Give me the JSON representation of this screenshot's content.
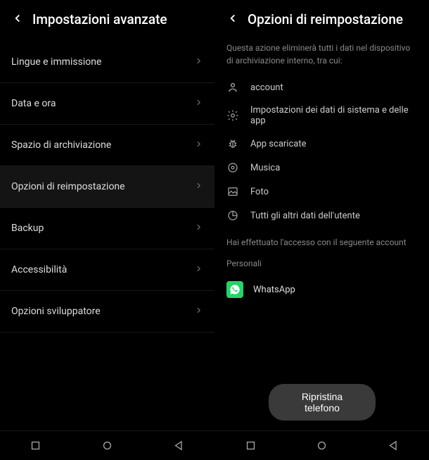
{
  "left": {
    "title": "Impostazioni avanzate",
    "items": [
      {
        "label": "Lingue e immissione"
      },
      {
        "label": "Data e ora"
      },
      {
        "label": "Spazio di archiviazione"
      },
      {
        "label": "Opzioni di reimpostazione",
        "selected": true
      },
      {
        "label": "Backup"
      },
      {
        "label": "Accessibilità"
      },
      {
        "label": "Opzioni sviluppatore"
      }
    ]
  },
  "right": {
    "title": "Opzioni di reimpostazione",
    "description": "Questa azione eliminerà tutti i dati nel dispositivo di archiviazione interno, tra cui:",
    "data_items": [
      {
        "icon": "person-icon",
        "label": "account"
      },
      {
        "icon": "gear-icon",
        "label": "Impostazioni dei dati di sistema e delle app"
      },
      {
        "icon": "bug-icon",
        "label": "App scaricate"
      },
      {
        "icon": "music-icon",
        "label": "Musica"
      },
      {
        "icon": "photo-icon",
        "label": "Foto"
      },
      {
        "icon": "pie-icon",
        "label": "Tutti gli altri dati dell'utente"
      }
    ],
    "account_notice": "Hai effettuato l'accesso con il seguente account",
    "section_label": "Personali",
    "account_app": "WhatsApp",
    "reset_button": "Ripristina telefono"
  }
}
